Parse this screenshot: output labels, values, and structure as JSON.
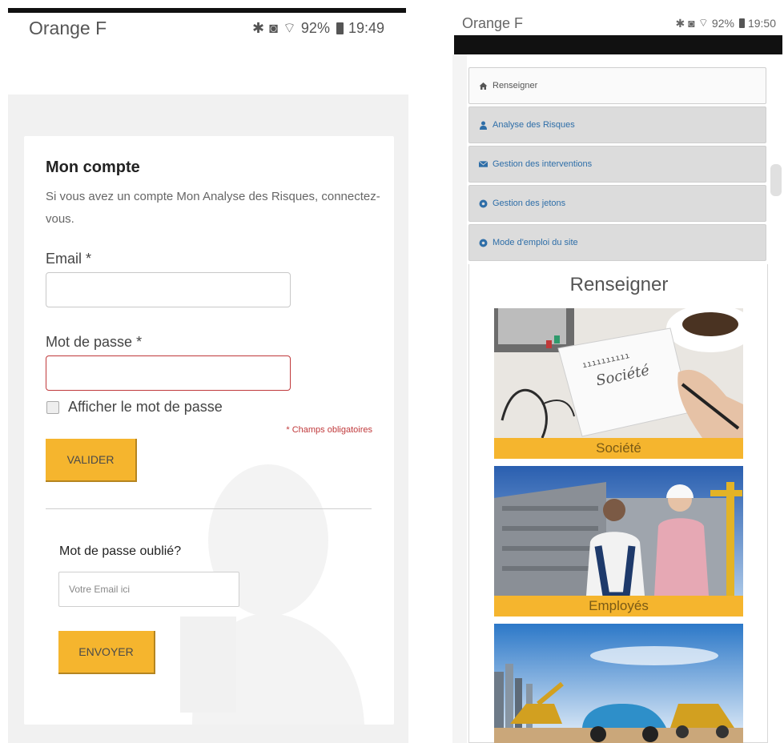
{
  "left_phone": {
    "status_bar": {
      "carrier": "Orange F",
      "battery": "92%",
      "time": "19:49"
    },
    "card": {
      "title": "Mon compte",
      "description": "Si vous avez un compte Mon Analyse des Risques, connectez-vous.",
      "email_label": "Email *",
      "email_value": "",
      "password_label": "Mot de passe *",
      "password_value": "",
      "show_password_label": "Afficher le mot de passe",
      "show_password_checked": false,
      "required_note": "* Champs obligatoires",
      "submit_label": "VALIDER",
      "forgot_title": "Mot de passe oublié?",
      "forgot_placeholder": "Votre Email ici",
      "send_label": "ENVOYER"
    }
  },
  "right_phone": {
    "status_bar": {
      "carrier": "Orange F",
      "battery": "92%",
      "time": "19:50"
    },
    "nav": [
      {
        "label": "Renseigner",
        "icon": "home-icon",
        "active": true
      },
      {
        "label": "Analyse des Risques",
        "icon": "user-icon",
        "active": false
      },
      {
        "label": "Gestion des interventions",
        "icon": "envelope-icon",
        "active": false
      },
      {
        "label": "Gestion des jetons",
        "icon": "circle-icon",
        "active": false
      },
      {
        "label": "Mode d'emploi du site",
        "icon": "circle-icon",
        "active": false
      }
    ],
    "content_title": "Renseigner",
    "tiles": [
      {
        "caption": "Société",
        "image_text": "Société"
      },
      {
        "caption": "Employés"
      },
      {
        "caption": ""
      }
    ]
  },
  "colors": {
    "accent_yellow": "#f5b52e",
    "error_red": "#c0393b",
    "link_blue": "#2e6ea8"
  }
}
